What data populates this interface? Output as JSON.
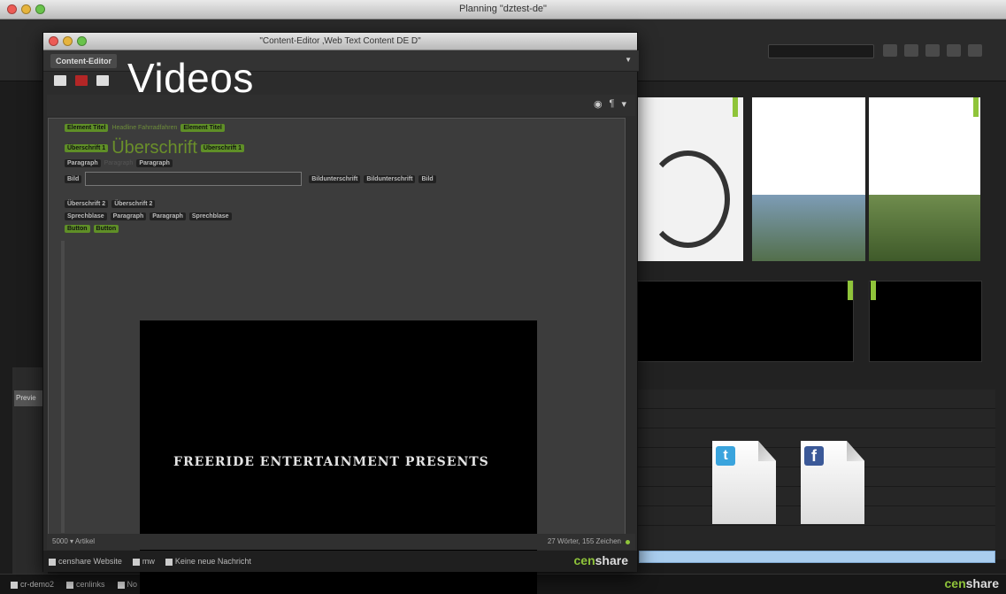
{
  "back_window": {
    "title": "Planning \"dztest-de\"",
    "search_placeholder": "",
    "status_items": [
      "cr-demo2",
      "cenlinks",
      "No new message"
    ],
    "logo_prefix": "cen",
    "logo_suffix": "share",
    "side_tab_label": "Previe"
  },
  "front_window": {
    "title": "\"Content-Editor ‚Web Text Content DE D\"",
    "tab_label": "Content-Editor",
    "overlay_caption": "Videos",
    "editor": {
      "line1": [
        "Element Titel",
        "Element Titel"
      ],
      "line1_faded": "Headline Fahrradfahren",
      "line2_tag_left": "Überschrift 1",
      "line2_heading": "Überschrift",
      "line2_tag_right": "Überschrift 1",
      "line3": [
        "Paragraph",
        "Paragraph",
        "Paragraph"
      ],
      "line4_tag": "Bild",
      "line4_right": [
        "Bildunterschrift",
        "Bildunterschrift",
        "Bild"
      ],
      "line5": [
        "Überschrift 2",
        "Überschrift 2"
      ],
      "line6": [
        "Sprechblase",
        "Paragraph",
        "Paragraph",
        "Sprechblase"
      ],
      "line7": [
        "Button",
        "Button"
      ]
    },
    "video_text": "FREERIDE ENTERTAINMENT PRESENTS",
    "footer_left": "5000",
    "footer_left_label": "Artikel",
    "footer_right": "27 Wörter, 155 Zeichen",
    "status_items": [
      "censhare Website",
      "mw",
      "Keine neue Nachricht"
    ],
    "logo_prefix": "cen",
    "logo_suffix": "share"
  },
  "social_icons": [
    {
      "name": "twitter",
      "glyph": "t",
      "color": "#3aa4dd"
    },
    {
      "name": "facebook",
      "glyph": "f",
      "color": "#3b5998"
    }
  ],
  "accent_colors": {
    "brand_green": "#8fc43a",
    "selection_blue": "#a9cdee"
  }
}
